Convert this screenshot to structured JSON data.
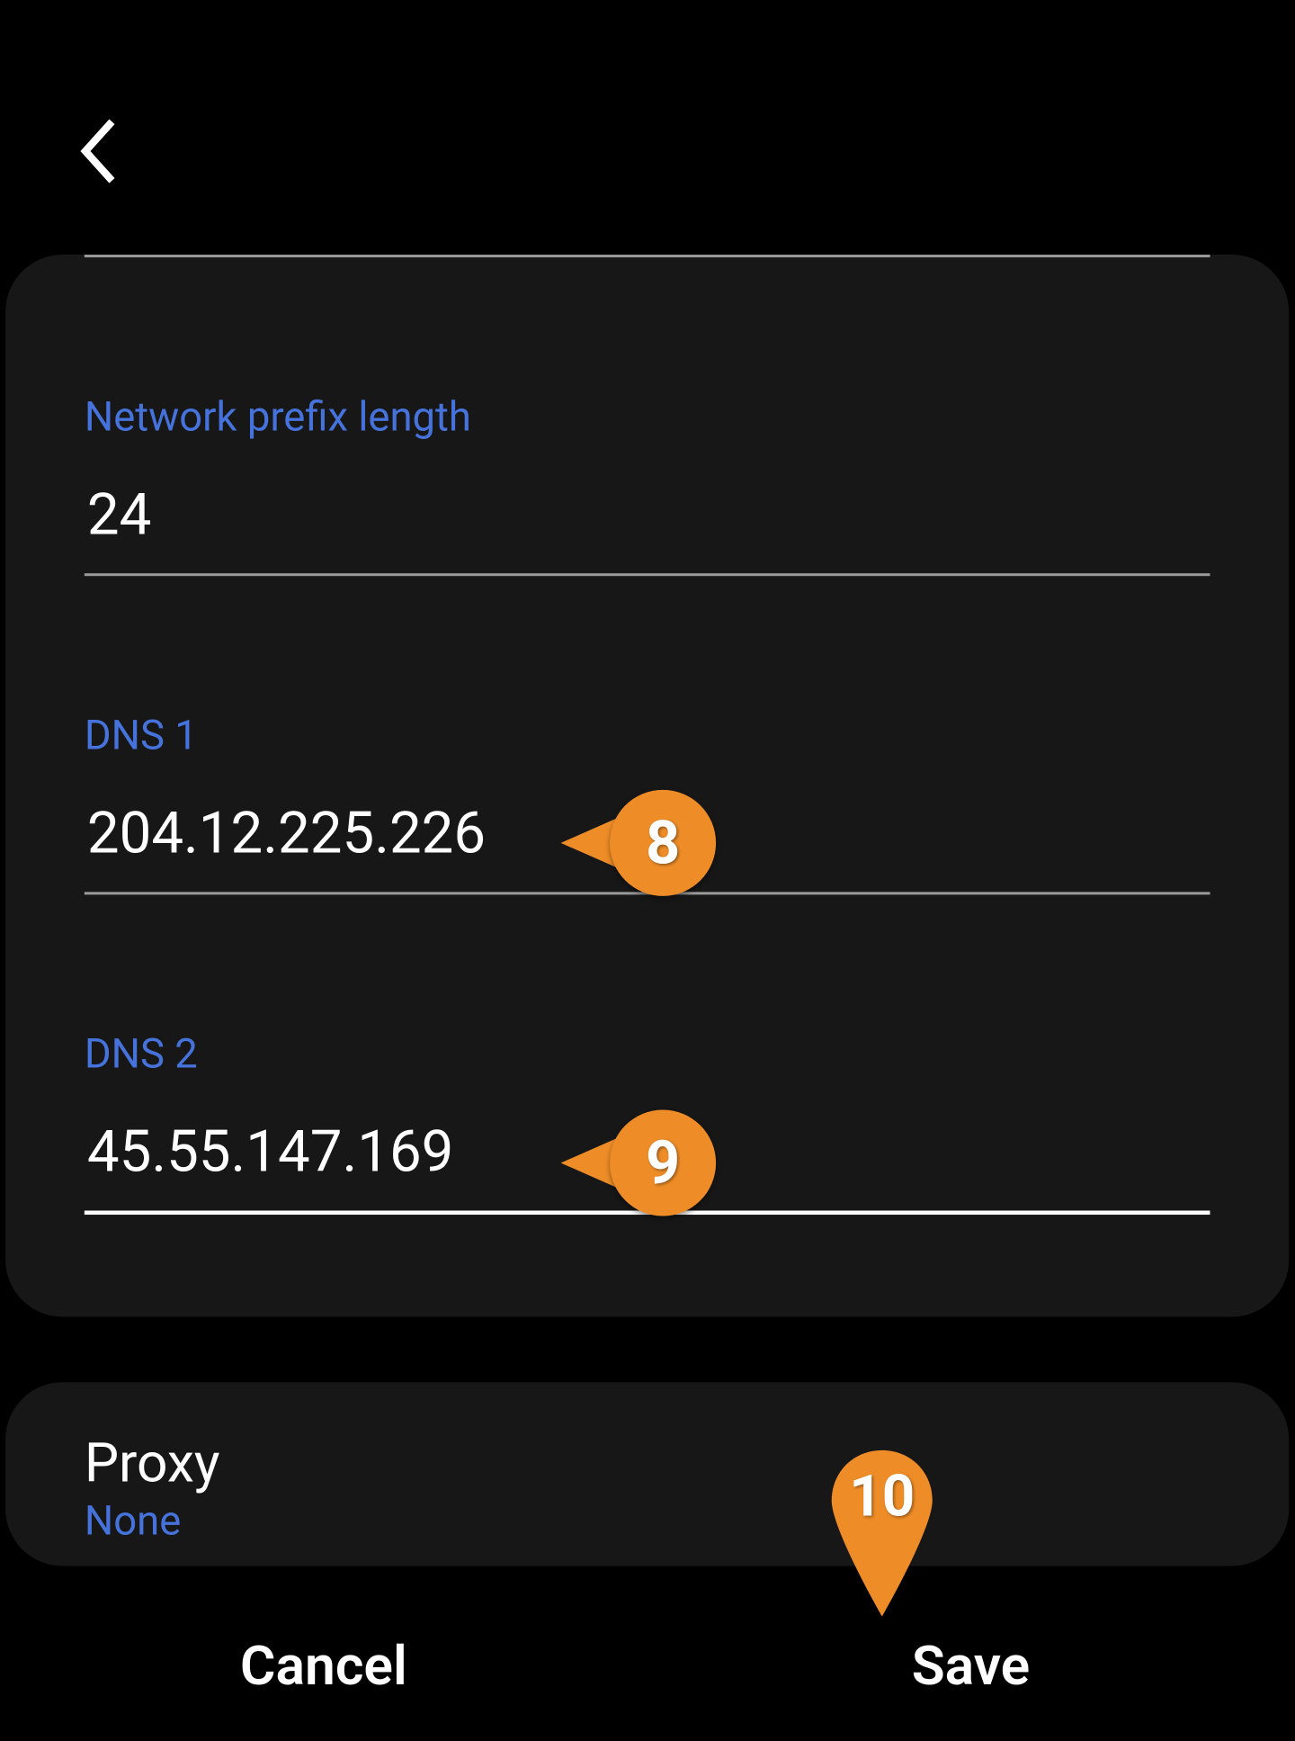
{
  "fields": {
    "prefix": {
      "label": "Network prefix length",
      "value": "24"
    },
    "dns1": {
      "label": "DNS 1",
      "value": "204.12.225.226"
    },
    "dns2": {
      "label": "DNS 2",
      "value": "45.55.147.169"
    }
  },
  "proxy": {
    "title": "Proxy",
    "value": "None"
  },
  "footer": {
    "cancel": "Cancel",
    "save": "Save"
  },
  "callouts": {
    "dns1": "8",
    "dns2": "9",
    "save": "10"
  }
}
